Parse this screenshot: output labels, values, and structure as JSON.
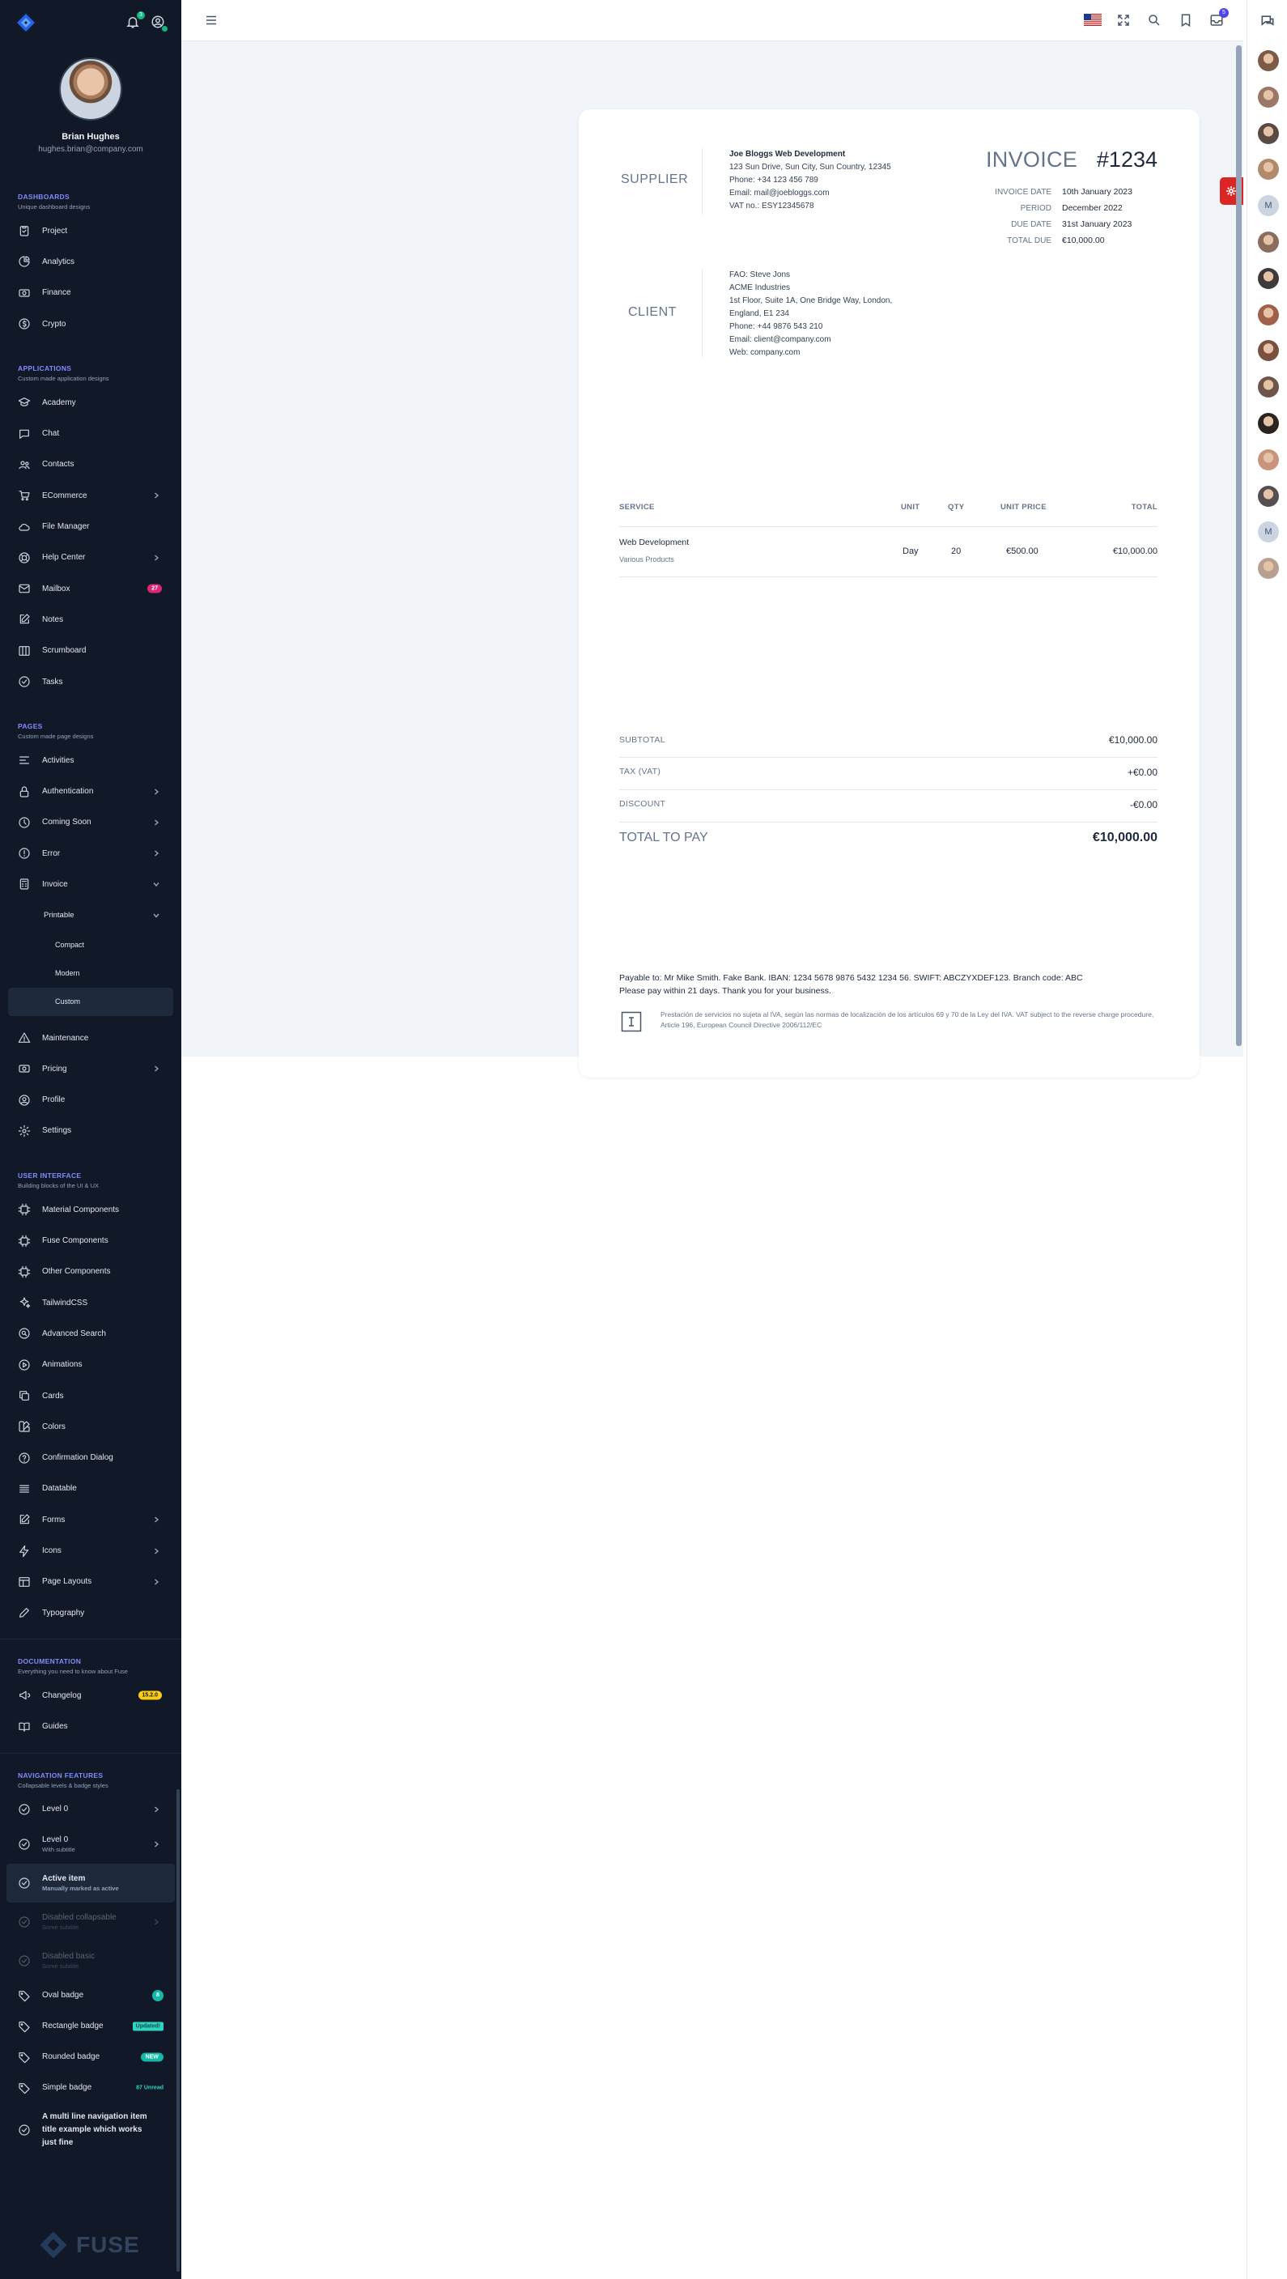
{
  "user": {
    "name": "Brian Hughes",
    "email": "hughes.brian@company.com",
    "notification_count": "3"
  },
  "sections": {
    "dashboards": {
      "title": "DASHBOARDS",
      "subtitle": "Unique dashboard designs",
      "items": [
        {
          "label": "Project",
          "icon": "clipboard-check-icon"
        },
        {
          "label": "Analytics",
          "icon": "chart-pie-icon"
        },
        {
          "label": "Finance",
          "icon": "cash-icon"
        },
        {
          "label": "Crypto",
          "icon": "currency-dollar-icon"
        }
      ]
    },
    "applications": {
      "title": "APPLICATIONS",
      "subtitle": "Custom made application designs",
      "items": [
        {
          "label": "Academy",
          "icon": "academic-cap-icon"
        },
        {
          "label": "Chat",
          "icon": "chat-bubble-icon"
        },
        {
          "label": "Contacts",
          "icon": "user-group-icon"
        },
        {
          "label": "ECommerce",
          "icon": "shopping-cart-icon",
          "chevron": true
        },
        {
          "label": "File Manager",
          "icon": "cloud-icon"
        },
        {
          "label": "Help Center",
          "icon": "support-icon",
          "chevron": true
        },
        {
          "label": "Mailbox",
          "icon": "mail-icon",
          "badge": "27"
        },
        {
          "label": "Notes",
          "icon": "pencil-square-icon"
        },
        {
          "label": "Scrumboard",
          "icon": "view-boards-icon"
        },
        {
          "label": "Tasks",
          "icon": "check-circle-icon"
        }
      ]
    },
    "pages": {
      "title": "PAGES",
      "subtitle": "Custom made page designs",
      "items": [
        {
          "label": "Activities",
          "icon": "menu-alt-icon"
        },
        {
          "label": "Authentication",
          "icon": "lock-icon",
          "chevron": true
        },
        {
          "label": "Coming Soon",
          "icon": "clock-icon",
          "chevron": true
        },
        {
          "label": "Error",
          "icon": "exclamation-circle-icon",
          "chevron": true
        },
        {
          "label": "Invoice",
          "icon": "calculator-icon",
          "chevron": true
        }
      ],
      "invoice_sub": {
        "label": "Printable",
        "children": [
          "Compact",
          "Modern",
          "Custom"
        ]
      },
      "items_after": [
        {
          "label": "Maintenance",
          "icon": "exclamation-triangle-icon"
        },
        {
          "label": "Pricing",
          "icon": "cash-icon",
          "chevron": true
        },
        {
          "label": "Profile",
          "icon": "user-circle-icon"
        },
        {
          "label": "Settings",
          "icon": "cog-icon"
        }
      ]
    },
    "ui": {
      "title": "USER INTERFACE",
      "subtitle": "Building blocks of the UI & UX",
      "items": [
        {
          "label": "Material Components",
          "icon": "chip-icon"
        },
        {
          "label": "Fuse Components",
          "icon": "chip-icon"
        },
        {
          "label": "Other Components",
          "icon": "chip-icon"
        },
        {
          "label": "TailwindCSS",
          "icon": "sparkles-icon"
        },
        {
          "label": "Advanced Search",
          "icon": "search-circle-icon"
        },
        {
          "label": "Animations",
          "icon": "play-icon"
        },
        {
          "label": "Cards",
          "icon": "duplicate-icon"
        },
        {
          "label": "Colors",
          "icon": "color-swatch-icon"
        },
        {
          "label": "Confirmation Dialog",
          "icon": "question-icon"
        },
        {
          "label": "Datatable",
          "icon": "menu-icon"
        },
        {
          "label": "Forms",
          "icon": "pencil-alt-icon",
          "chevron": true
        },
        {
          "label": "Icons",
          "icon": "lightning-icon",
          "chevron": true
        },
        {
          "label": "Page Layouts",
          "icon": "template-icon",
          "chevron": true
        },
        {
          "label": "Typography",
          "icon": "pencil-icon"
        }
      ]
    },
    "docs": {
      "title": "DOCUMENTATION",
      "subtitle": "Everything you need to know about Fuse",
      "items": [
        {
          "label": "Changelog",
          "icon": "speakerphone-icon",
          "badge": "15.2.0"
        },
        {
          "label": "Guides",
          "icon": "book-open-icon"
        }
      ]
    },
    "navfeat": {
      "title": "NAVIGATION FEATURES",
      "subtitle": "Collapsable levels & badge styles",
      "items": [
        {
          "label": "Level 0",
          "sub": "",
          "chevron": true
        },
        {
          "label": "Level 0",
          "sub": "With subtitle",
          "chevron": true
        },
        {
          "label": "Active item",
          "sub": "Manually marked as active",
          "active": true
        },
        {
          "label": "Disabled collapsable",
          "sub": "Some subtitle",
          "chevron": true,
          "disabled": true
        },
        {
          "label": "Disabled basic",
          "sub": "Some subtitle",
          "disabled": true
        },
        {
          "label": "Oval badge",
          "badge": "8"
        },
        {
          "label": "Rectangle badge",
          "badge": "Updated!"
        },
        {
          "label": "Rounded badge",
          "badge": "NEW"
        },
        {
          "label": "Simple badge",
          "badge": "87 Unread"
        },
        {
          "label": "A multi line navigation item title example which works just fine"
        }
      ]
    }
  },
  "footer_logo": "FUSE",
  "topbar": {
    "messages_badge": "5"
  },
  "invoice": {
    "supplier_label": "SUPPLIER",
    "supplier": [
      "Joe Bloggs Web Development",
      "123 Sun Drive, Sun City, Sun Country, 12345",
      "Phone: +34 123 456 789",
      "Email: mail@joebloggs.com",
      "VAT no.: ESY12345678"
    ],
    "client_label": "CLIENT",
    "client": [
      "FAO: Steve Jons",
      "ACME Industries",
      "1st Floor, Suite 1A, One Bridge Way, London,",
      "England, E1 234",
      "Phone: +44 9876 543 210",
      "Email: client@company.com",
      "Web: company.com"
    ],
    "title": "INVOICE",
    "number": "#1234",
    "meta": [
      {
        "k": "INVOICE DATE",
        "v": "10th January 2023"
      },
      {
        "k": "PERIOD",
        "v": "December 2022"
      },
      {
        "k": "DUE DATE",
        "v": "31st January 2023"
      },
      {
        "k": "TOTAL DUE",
        "v": "€10,000.00"
      }
    ],
    "columns": {
      "service": "SERVICE",
      "unit": "UNIT",
      "qty": "QTY",
      "unit_price": "UNIT PRICE",
      "total": "TOTAL"
    },
    "rows": [
      {
        "service": "Web Development",
        "desc": "Various Products",
        "unit": "Day",
        "qty": "20",
        "unit_price": "€500.00",
        "total": "€10,000.00"
      }
    ],
    "subtotal": {
      "k": "SUBTOTAL",
      "v": "€10,000.00"
    },
    "tax": {
      "k": "TAX (VAT)",
      "v": "+€0.00"
    },
    "discount": {
      "k": "DISCOUNT",
      "v": "-€0.00"
    },
    "total": {
      "k": "TOTAL TO PAY",
      "v": "€10,000.00"
    },
    "payable": "Payable to: Mr Mike Smith. Fake Bank. IBAN: 1234 5678 9876 5432 1234 56. SWIFT: ABCZYXDEF123. Branch code: ABC",
    "payable_note": "Please pay within 21 days. Thank you for your business.",
    "legal": "Prestación de servicios no sujeta al IVA, según las normas de localización de los artículos 69 y 70 de la Ley del IVA. VAT subject to the reverse charge procedure, Article 196, European Council Directive 2006/112/EC"
  },
  "colors": {
    "sidebar_bg": "#111827",
    "accent": "#818cf8",
    "primary": "#4f46e5",
    "danger": "#dc2626",
    "main_bg": "#f1f5f9"
  }
}
